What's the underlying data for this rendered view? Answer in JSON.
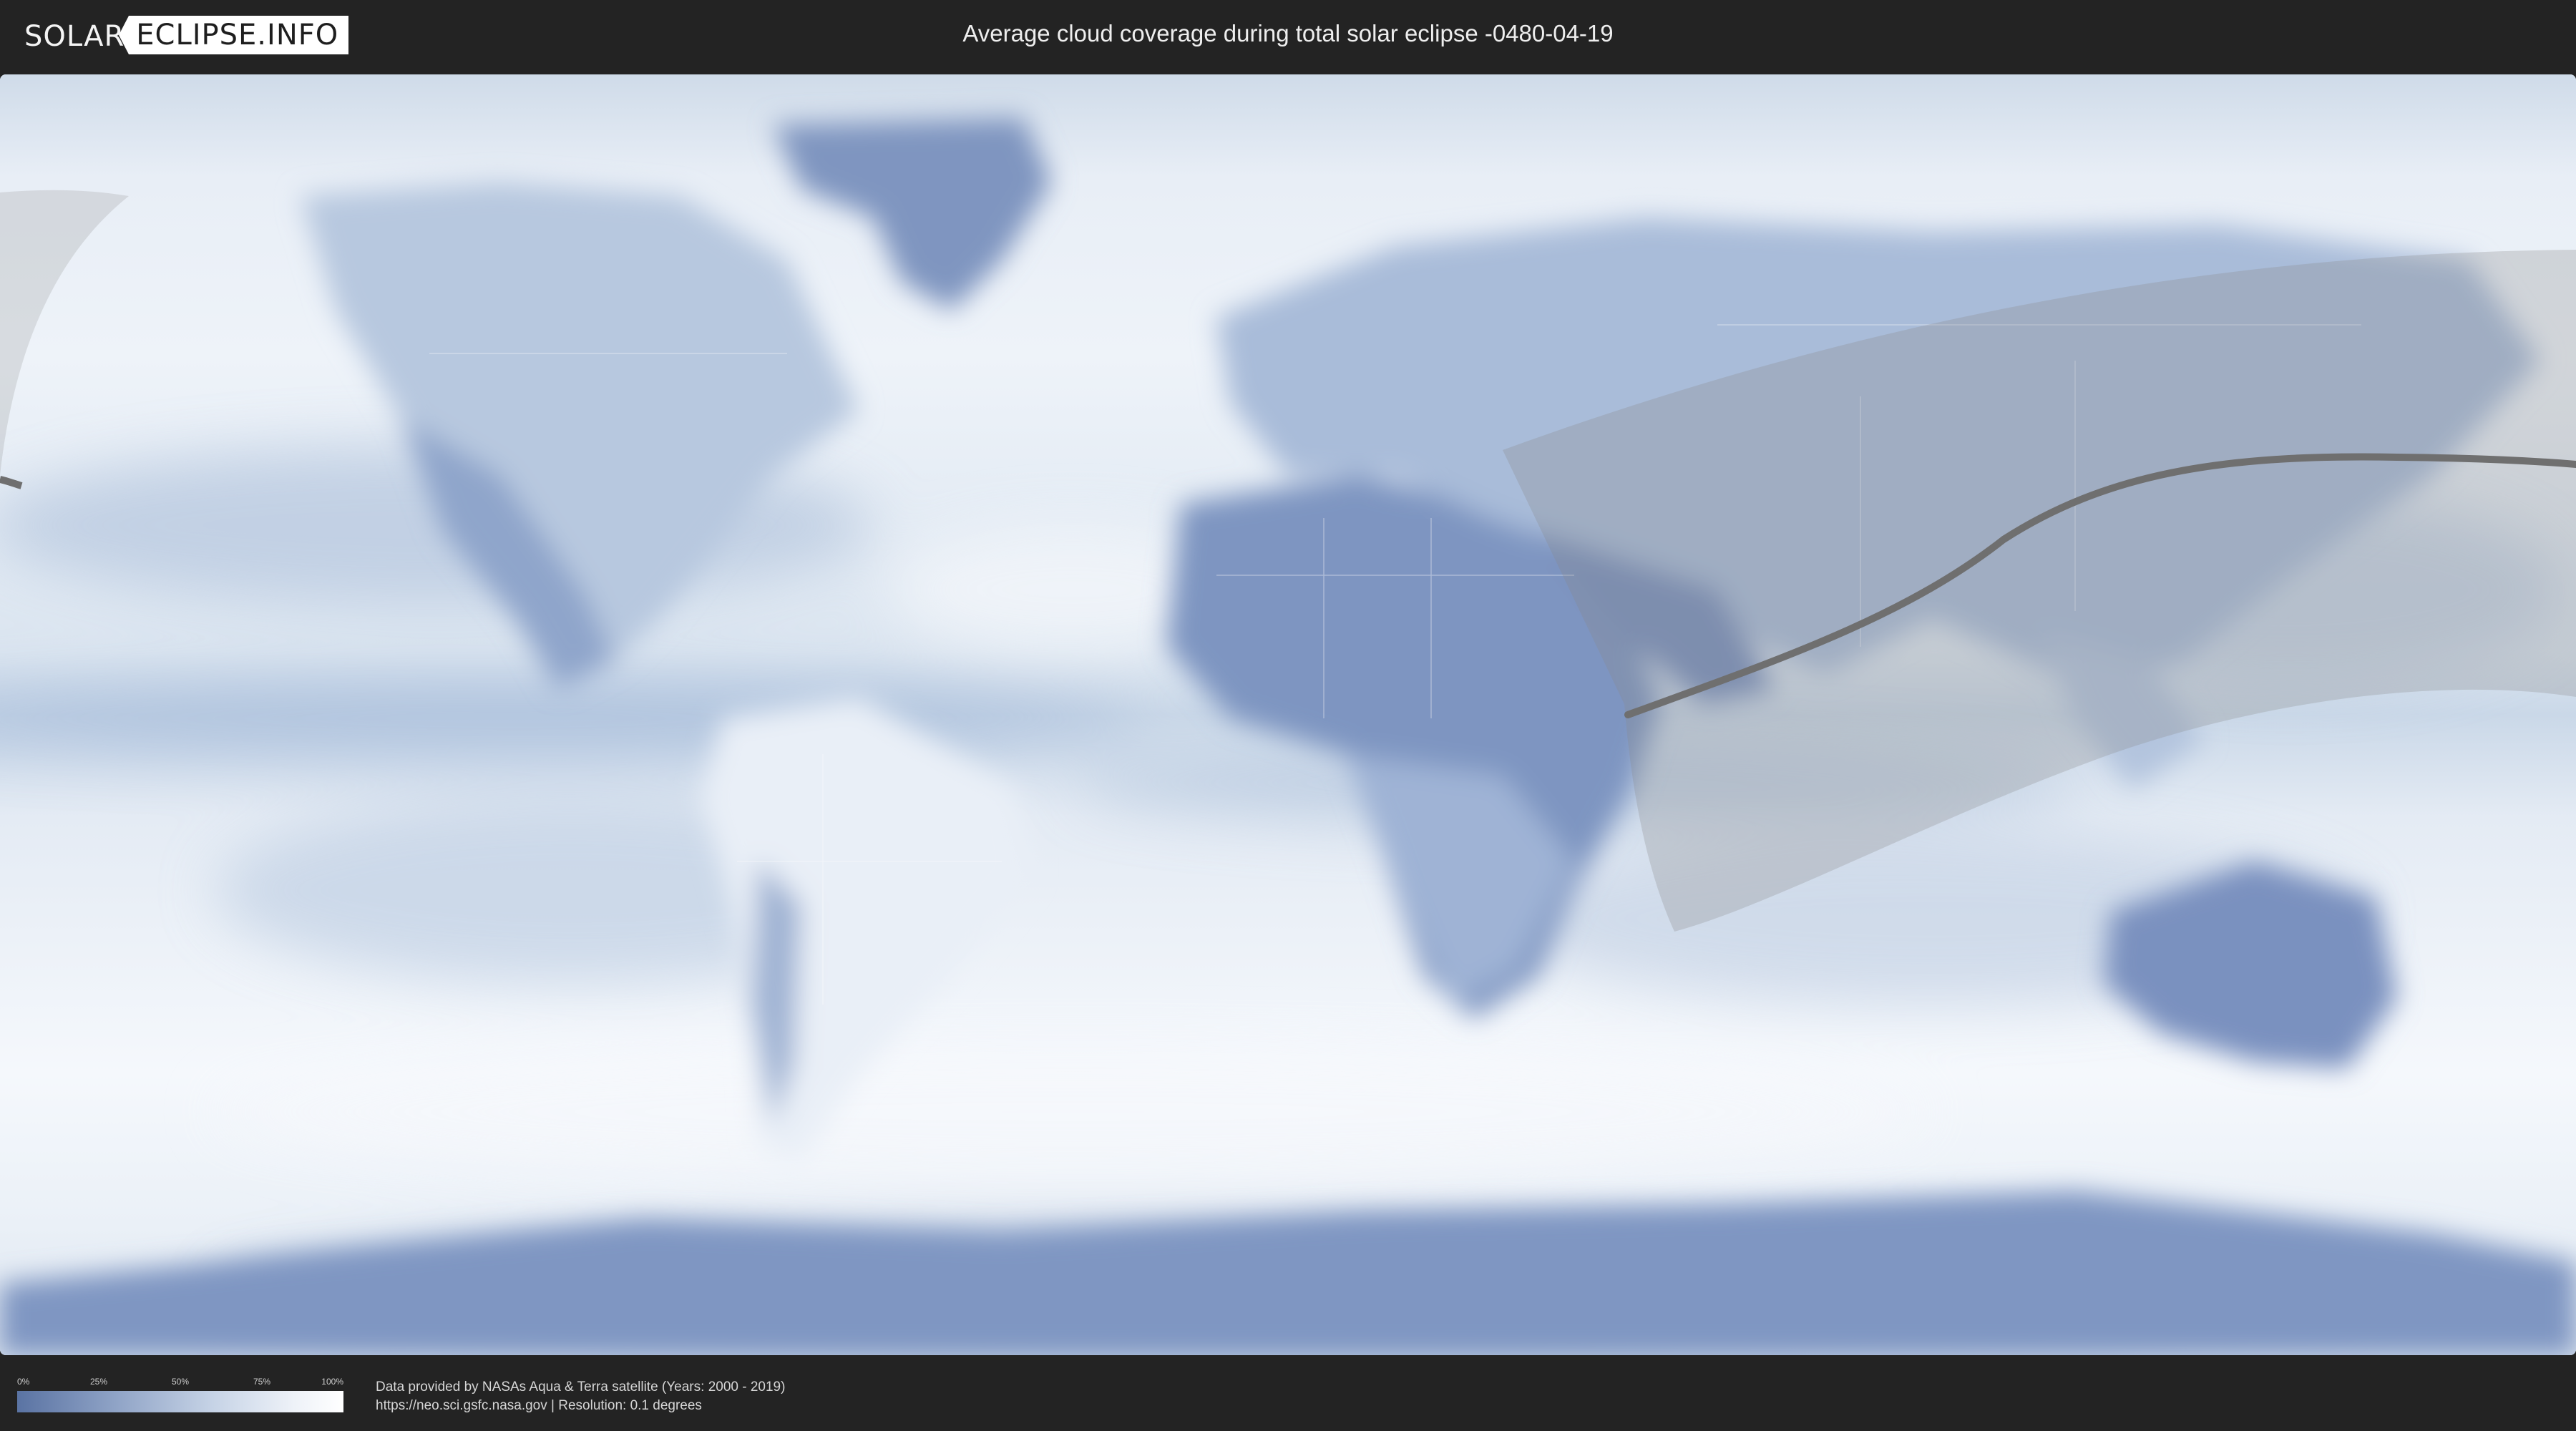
{
  "logo": {
    "left": "SOLAR",
    "right": "ECLIPSE.INFO"
  },
  "title": "Average cloud coverage during total solar eclipse -0480-04-19",
  "legend": {
    "ticks": [
      "0%",
      "25%",
      "50%",
      "75%",
      "100%"
    ],
    "colors": {
      "low": "#5a73a3",
      "high": "#ffffff"
    }
  },
  "credits": {
    "line1": "Data provided by NASAs Aqua & Terra satellite (Years: 2000 - 2019)",
    "line2": "https://neo.sci.gsfc.nasa.gov | Resolution: 0.1 degrees"
  },
  "map": {
    "projection": "equirectangular",
    "layers": [
      "cloud-coverage",
      "country-borders",
      "eclipse-visibility-zone",
      "totality-path"
    ],
    "colors": {
      "clear": "#5f78a8",
      "cloudy": "#ffffff",
      "zone": "#8a8a8a",
      "path": "#6f6f6f"
    }
  }
}
